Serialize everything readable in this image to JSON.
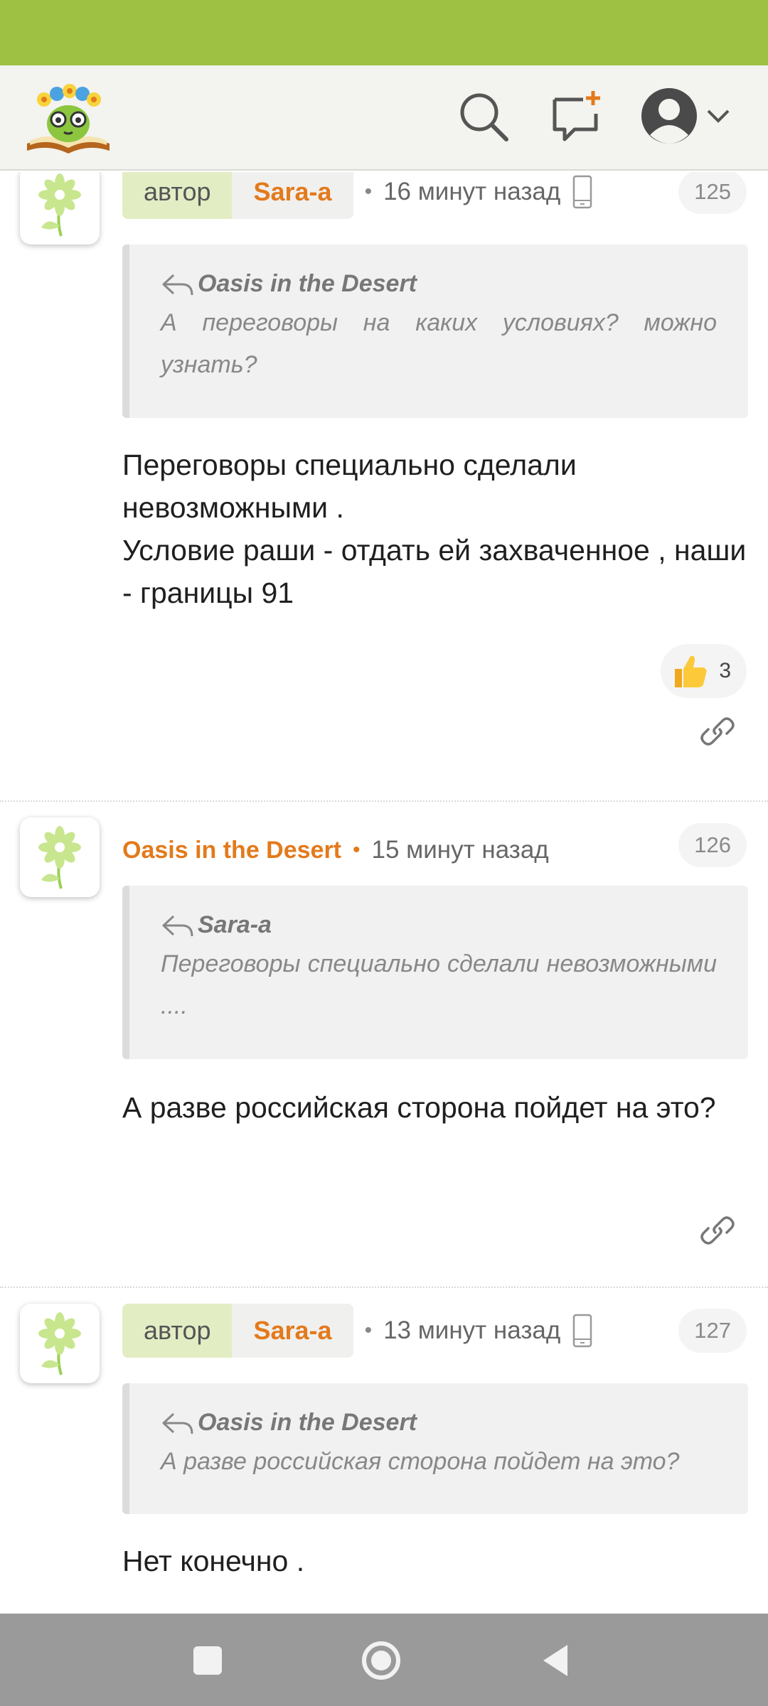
{
  "posts": [
    {
      "author_tag": "автор",
      "username": "Sara-a",
      "time": "16 минут назад",
      "number": "125",
      "quote_author": "Oasis in the Desert",
      "quote_text": "А переговоры на каких условиях? можно узнать?",
      "body": "Переговоры специально сделали невозможными .\nУсловие раши - отдать ей захваченное , наши - границы 91",
      "likes": "3"
    },
    {
      "username": "Oasis in the Desert",
      "time": "15 минут назад",
      "number": "126",
      "quote_author": "Sara-a",
      "quote_text": "Переговоры специально сделали невозможными ....",
      "body": "А разве российская сторона пойдет на это?"
    },
    {
      "author_tag": "автор",
      "username": "Sara-a",
      "time": "13 минут назад",
      "number": "127",
      "quote_author": "Oasis in the Desert",
      "quote_text": "А разве российская сторона пойдет на это?",
      "body": "Нет конечно ."
    }
  ],
  "icons": {
    "search": "search-icon",
    "new_message": "new-message-icon",
    "profile": "user-avatar-icon",
    "reply": "reply-arrow-icon",
    "device": "mobile-phone-icon",
    "like": "thumbs-up-icon",
    "link": "link-icon"
  },
  "colors": {
    "status_bar": "#9ec144",
    "username": "#e37a1c",
    "author_tag_bg": "#e2edc4",
    "navbar": "#9a9a9a"
  }
}
